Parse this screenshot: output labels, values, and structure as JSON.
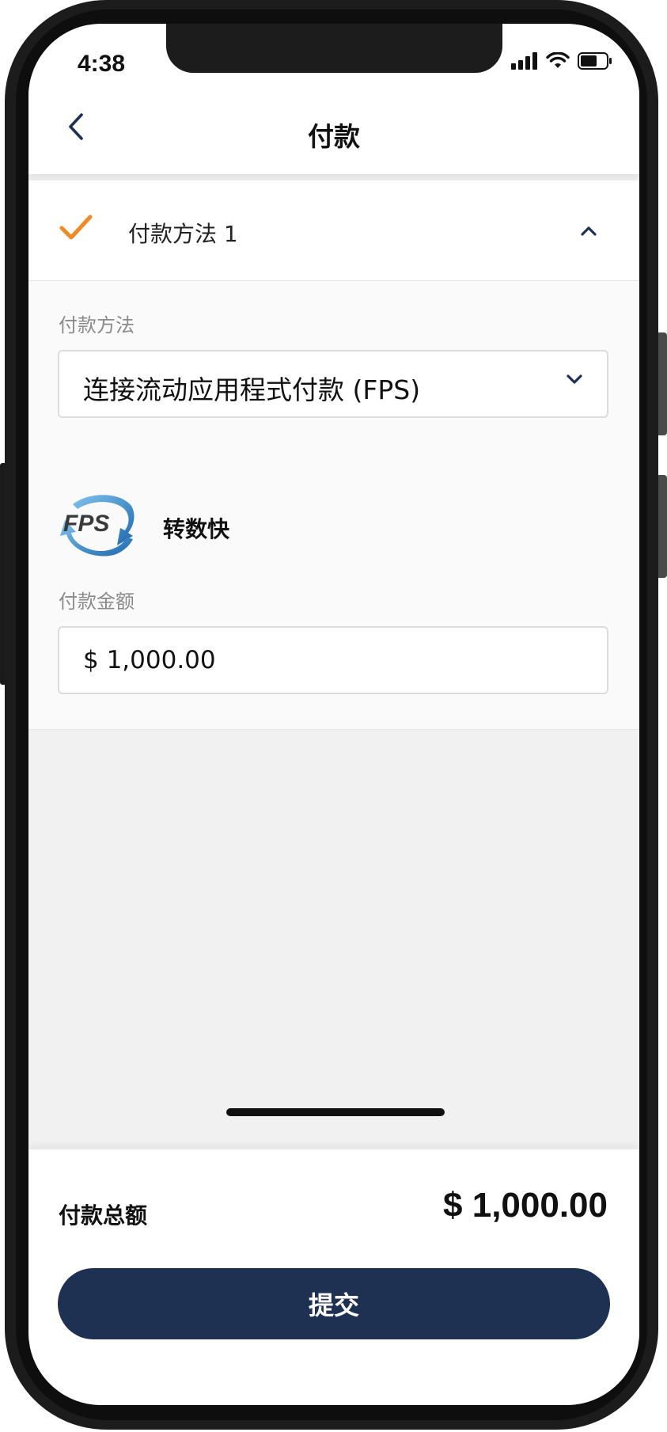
{
  "status_bar": {
    "time": "4:38"
  },
  "header": {
    "title": "付款"
  },
  "payment_section": {
    "title": "付款方法 1",
    "expanded": true
  },
  "form": {
    "method_label": "付款方法",
    "method_value": "连接流动应用程式付款 (FPS)",
    "logo_text": "FPS",
    "provider_name": "转数快",
    "amount_label": "付款金额",
    "amount_value": "$ 1,000.00"
  },
  "footer": {
    "total_label": "付款总额",
    "total_value": "$ 1,000.00",
    "submit_label": "提交"
  },
  "colors": {
    "accent_orange": "#f08a24",
    "primary_navy": "#1e3153",
    "fps_blue": "#2a7fc4"
  }
}
